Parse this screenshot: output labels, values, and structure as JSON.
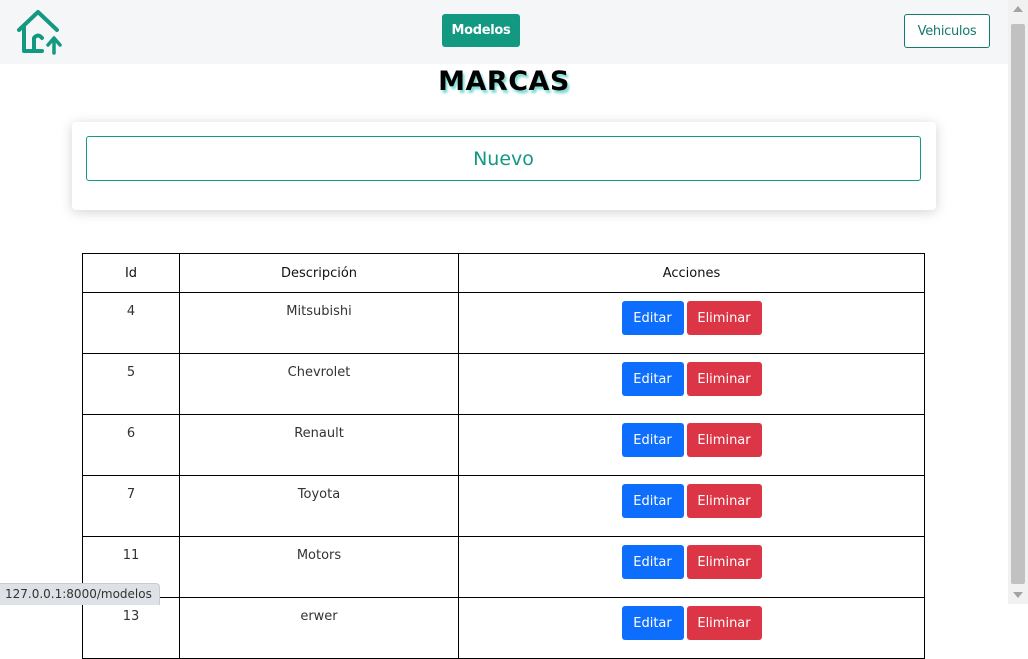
{
  "nav": {
    "home_icon": "home-arrow-up-icon",
    "modelos_label": "Modelos",
    "vehiculos_label": "Vehiculos"
  },
  "page": {
    "title": "MARCAS",
    "new_button_label": "Nuevo"
  },
  "table": {
    "headers": {
      "id": "Id",
      "description": "Descripción",
      "actions": "Acciones"
    },
    "edit_label": "Editar",
    "delete_label": "Eliminar",
    "rows": [
      {
        "id": "4",
        "description": "Mitsubishi"
      },
      {
        "id": "5",
        "description": "Chevrolet"
      },
      {
        "id": "6",
        "description": "Renault"
      },
      {
        "id": "7",
        "description": "Toyota"
      },
      {
        "id": "11",
        "description": "Motors"
      },
      {
        "id": "13",
        "description": "erwer"
      }
    ]
  },
  "status_bar": {
    "url": "127.0.0.1:8000/modelos"
  },
  "colors": {
    "accent": "#139982",
    "edit": "#0d6efd",
    "delete": "#dc3545",
    "navbar_bg": "#f5f6f8"
  }
}
